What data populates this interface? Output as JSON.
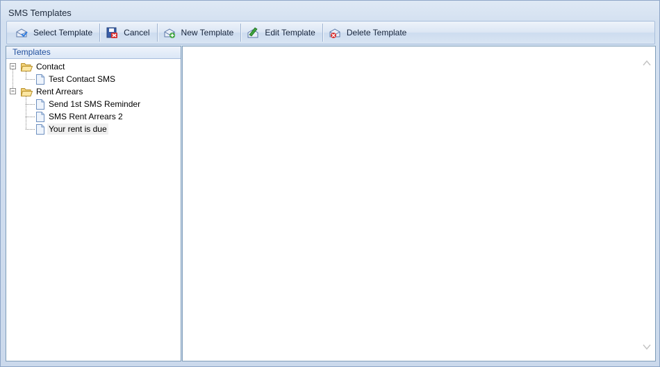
{
  "window": {
    "title": "SMS Templates"
  },
  "toolbar": {
    "buttons": [
      {
        "label": "Select Template",
        "icon": "select-template-icon"
      },
      {
        "label": "Cancel",
        "icon": "cancel-icon"
      },
      {
        "label": "New Template",
        "icon": "new-template-icon"
      },
      {
        "label": "Edit Template",
        "icon": "edit-template-icon"
      },
      {
        "label": "Delete Template",
        "icon": "delete-template-icon"
      }
    ]
  },
  "templates_panel": {
    "header": "Templates",
    "tree": [
      {
        "folder": "Contact",
        "expanded": true,
        "items": [
          "Test Contact SMS"
        ]
      },
      {
        "folder": "Rent Arrears",
        "expanded": true,
        "items": [
          "Send 1st SMS Reminder",
          "SMS Rent Arrears 2",
          "Your rent is due"
        ]
      }
    ],
    "selected_item": "Your rent is due"
  },
  "colors": {
    "accent": "#1f4e9c",
    "window_bg": "#cbd9ec",
    "border": "#7f9db9"
  }
}
